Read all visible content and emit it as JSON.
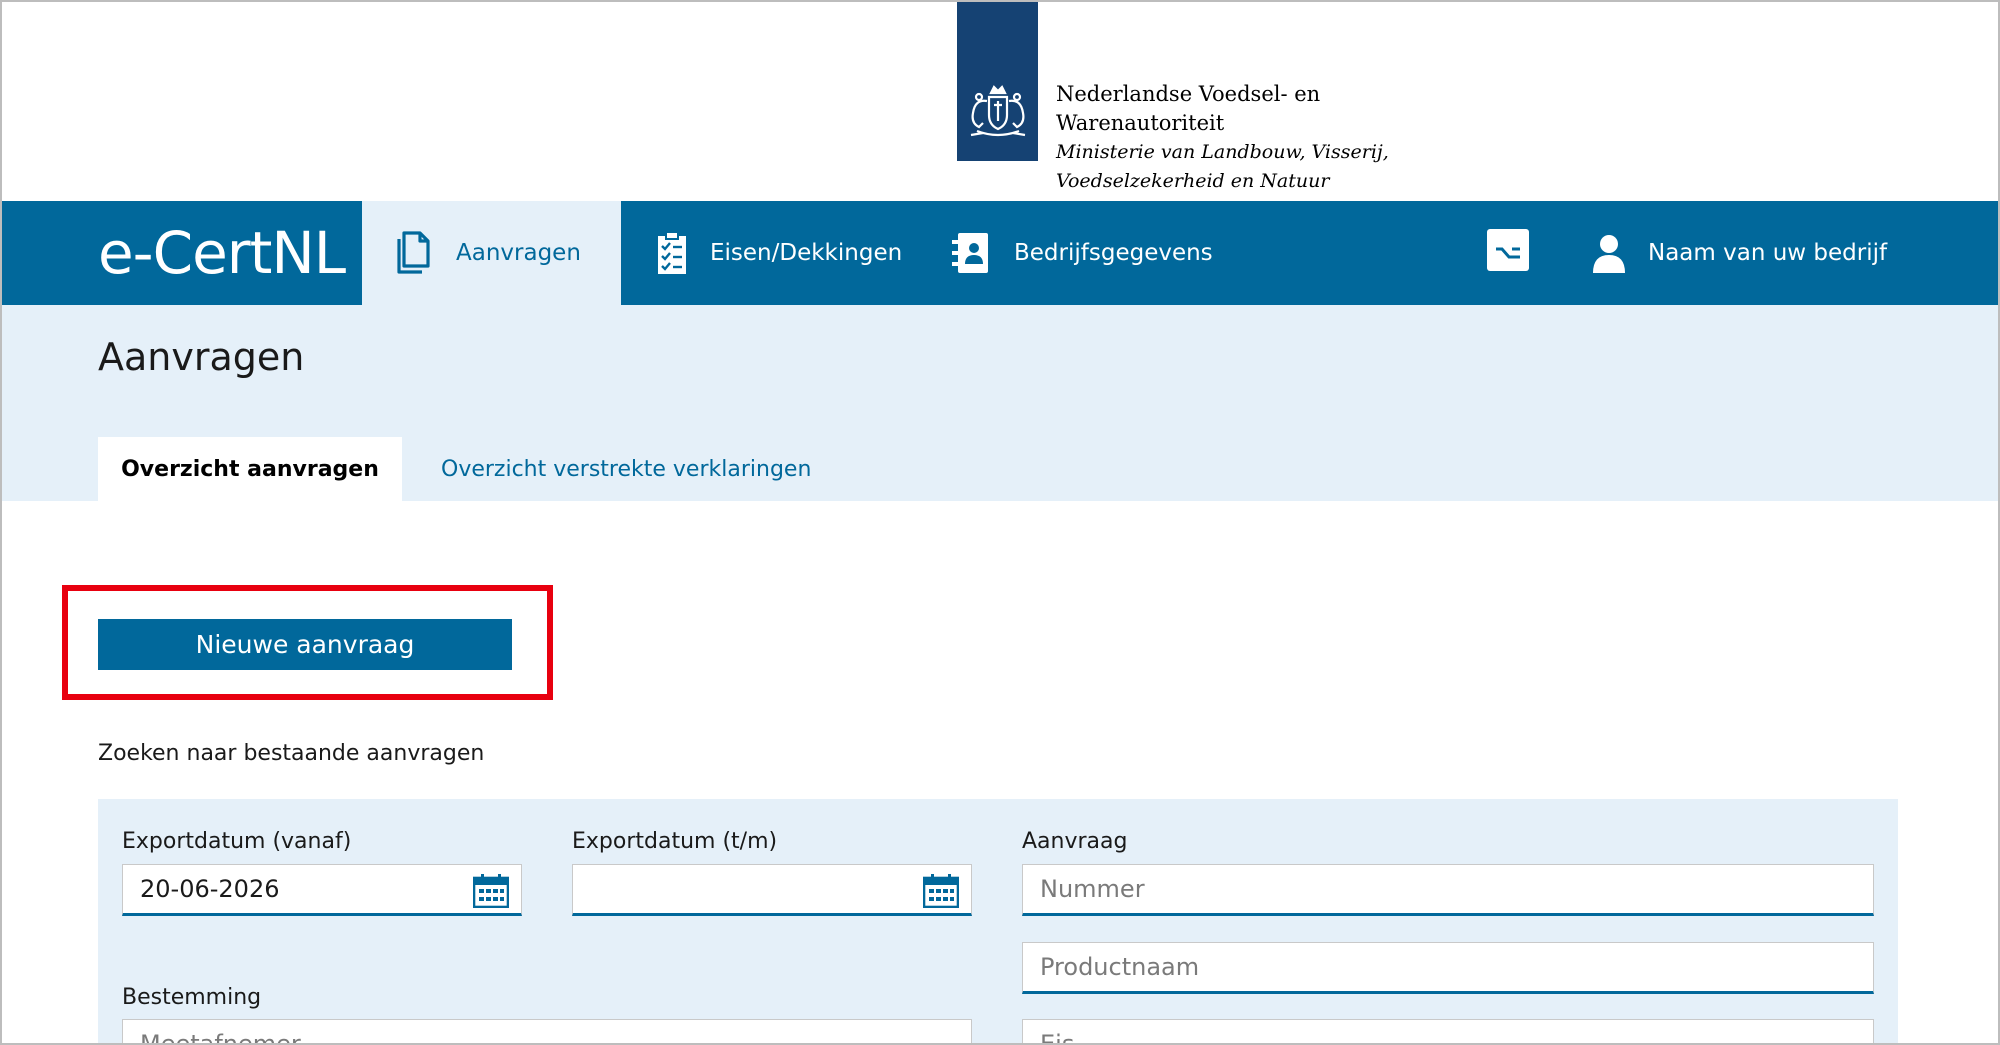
{
  "logo": {
    "line1": "Nederlandse Voedsel- en",
    "line2": "Warenautoriteit",
    "line3": "Ministerie van Landbouw, Visserij,",
    "line4": "Voedselzekerheid en Natuur",
    "emblem": "rijkswapen-emblem"
  },
  "nav": {
    "brand": "e-CertNL",
    "items": [
      {
        "label": "Aanvragen",
        "icon": "documents-icon",
        "active": true
      },
      {
        "label": "Eisen/Dekkingen",
        "icon": "checklist-icon"
      },
      {
        "label": "Bedrijfsgegevens",
        "icon": "contact-book-icon"
      }
    ],
    "util_icon": "option-key-icon",
    "user": {
      "label": "Naam van uw bedrijf",
      "icon": "user-icon"
    }
  },
  "page": {
    "title": "Aanvragen",
    "tabs": [
      {
        "label": "Overzicht aanvragen",
        "active": true
      },
      {
        "label": "Overzicht verstrekte verklaringen"
      }
    ]
  },
  "actions": {
    "new_request": "Nieuwe aanvraag"
  },
  "search": {
    "heading": "Zoeken naar bestaande aanvragen",
    "fields": {
      "export_from": {
        "label": "Exportdatum (vanaf)",
        "value": "20-06-2026"
      },
      "export_to": {
        "label": "Exportdatum (t/m)",
        "value": ""
      },
      "aanvraag": {
        "label": "Aanvraag",
        "placeholder_nummer": "Nummer",
        "placeholder_product": "Productnaam"
      },
      "bestemming": {
        "label": "Bestemming",
        "placeholder": "Meetafnemer"
      },
      "eis": {
        "placeholder": "Eis"
      }
    }
  },
  "colors": {
    "brand_blue": "#01689b",
    "logo_blue": "#154273",
    "light_blue": "#e5f0f9",
    "highlight_red": "#e8000f"
  }
}
